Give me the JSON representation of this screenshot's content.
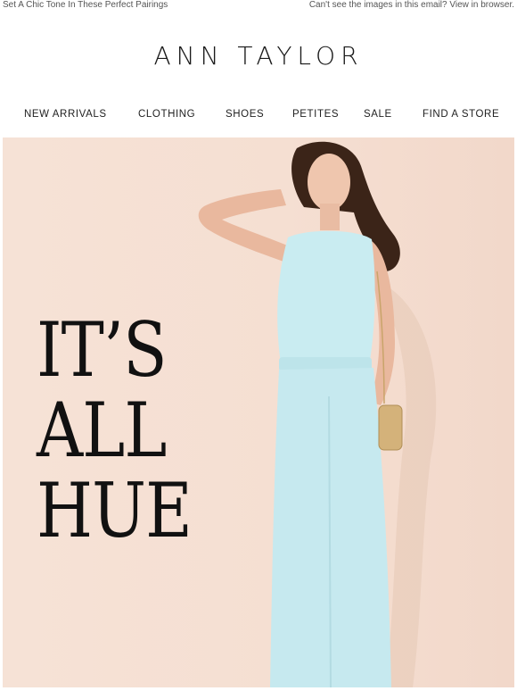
{
  "preheader": {
    "left_text": "Set A Chic Tone In These Perfect Pairings",
    "right_text": "Can't see the images in this email? View in browser."
  },
  "brand": {
    "logo_text": "ANN TAYLOR"
  },
  "nav": {
    "items": [
      {
        "label": "NEW ARRIVALS"
      },
      {
        "label": "CLOTHING"
      },
      {
        "label": "SHOES"
      },
      {
        "label": "PETITES"
      },
      {
        "label": "SALE"
      },
      {
        "label": "FIND A STORE"
      }
    ]
  },
  "hero": {
    "headline_lines": [
      "IT’S",
      "ALL",
      "HUE"
    ],
    "colors": {
      "background": "#f5dfd2",
      "jumpsuit": "#c9ecf1",
      "text": "#111111"
    }
  }
}
